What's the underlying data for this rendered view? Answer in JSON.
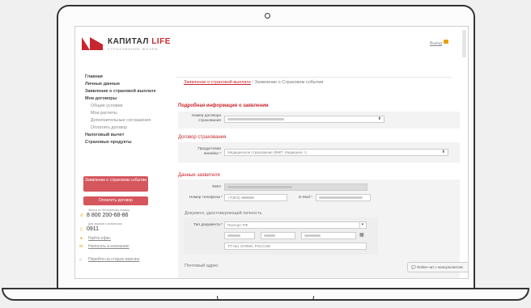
{
  "header": {
    "logo_text": "КАПИТАЛ",
    "logo_life": "LIFE",
    "logo_subtitle": "СТРАХОВАНИЕ ЖИЗНИ",
    "logout_label": "Выход"
  },
  "sidebar": {
    "nav": [
      {
        "label": "Главная"
      },
      {
        "label": "Личные данные"
      },
      {
        "label": "Заявление о страховой выплате"
      },
      {
        "label": "Мои договоры"
      },
      {
        "label": "Общие условия"
      },
      {
        "label": "Мои расчеты"
      },
      {
        "label": "Дополнительные соглашения"
      },
      {
        "label": "Оплатить договор"
      },
      {
        "label": "Налоговый вычет"
      },
      {
        "label": "Страховые продукты"
      }
    ],
    "claim_button": "Заявление о страховом событии",
    "pay_button": "Оплатить договор",
    "free_call_note": "Звонок по бесплатному номеру",
    "free_phone": "8 800 200-68-86",
    "mobile_note": "Для звонков с мобильных",
    "short_phone": "0911",
    "find_office": "Найти офис",
    "write_company": "Написать в компанию",
    "old_version": "Перейти на старую версию"
  },
  "main": {
    "breadcrumb_link": "Заявление о страховой выплате",
    "breadcrumb_sep": "/",
    "breadcrumb_current": "Заявление о Страховом событии",
    "section_details": "Подробная информация о заявлении",
    "contract_number_label": "Номер договора страхования",
    "section_contract": "Договор страхования",
    "product_label": "Продуктовая линейка *",
    "product_value": "Медицинское страхование (ВМП, Медицина +)",
    "section_applicant": "Данные заявителя",
    "fio_label": "ФИО",
    "phone_label": "Номер телефона *",
    "phone_value": "+7(903)",
    "email_label": "E-Mail *",
    "identity_doc_label": "Документ, удостоверяющий личность",
    "doc_type_label": "Тип документа *",
    "doc_type_value": "Паспорт РФ",
    "issued_by_value": "ТП №1 ОУФМС РОССИИ",
    "postal_address_label": "Почтовый адрес"
  },
  "chat": {
    "label": "Online-чат с консультантом"
  }
}
